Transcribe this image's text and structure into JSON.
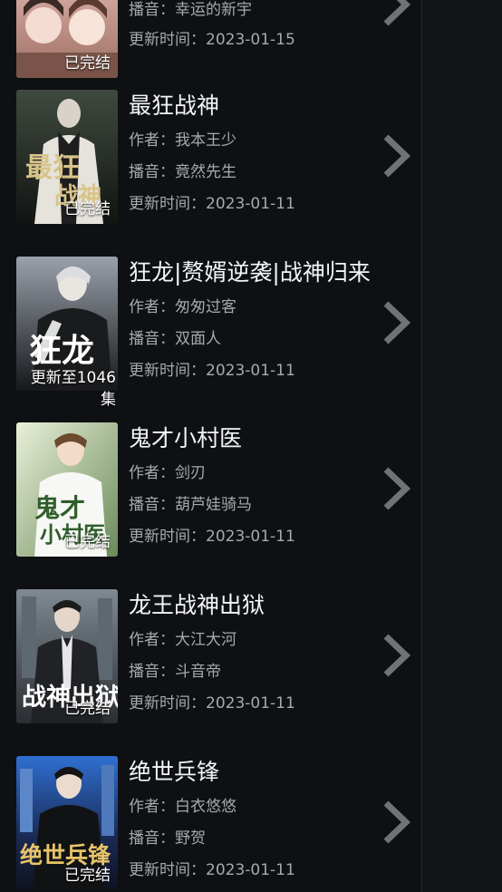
{
  "items": [
    {
      "title": "",
      "author_label": "",
      "author": "",
      "narrator_label": "播音：",
      "narrator": "幸运的新宇",
      "updated_label": "更新时间：",
      "updated": "2023-01-15",
      "badge": "已完结"
    },
    {
      "title": "最狂战神",
      "author_label": "作者：",
      "author": "我本王少",
      "narrator_label": "播音：",
      "narrator": "竟然先生",
      "updated_label": "更新时间：",
      "updated": "2023-01-11",
      "badge": "已完结",
      "cover_text": "最狂战神"
    },
    {
      "title": "狂龙|赘婿逆袭|战神归来",
      "author_label": "作者：",
      "author": "匆匆过客",
      "narrator_label": "播音：",
      "narrator": "双面人",
      "updated_label": "更新时间：",
      "updated": "2023-01-11",
      "badge": "更新至1046集",
      "cover_text": "狂龙"
    },
    {
      "title": "鬼才小村医",
      "author_label": "作者：",
      "author": "剑刃",
      "narrator_label": "播音：",
      "narrator": "葫芦娃骑马",
      "updated_label": "更新时间：",
      "updated": "2023-01-11",
      "badge": "已完结",
      "cover_text": "鬼才小村医"
    },
    {
      "title": "龙王战神出狱",
      "author_label": "作者：",
      "author": "大江大河",
      "narrator_label": "播音：",
      "narrator": "斗音帝",
      "updated_label": "更新时间：",
      "updated": "2023-01-11",
      "badge": "已完结",
      "cover_text": "战神出狱"
    },
    {
      "title": "绝世兵锋",
      "author_label": "作者：",
      "author": "白衣悠悠",
      "narrator_label": "播音：",
      "narrator": "野贺",
      "updated_label": "更新时间：",
      "updated": "2023-01-11",
      "badge": "已完结",
      "cover_text": "绝世兵锋"
    }
  ],
  "colors": {
    "background": "#0e1013",
    "title": "#f3f4f5",
    "meta": "#a6a9ad",
    "chevron": "#6f7378",
    "divider": "#2a2d31"
  },
  "icons": {
    "chevron": "chevron-right-icon"
  }
}
